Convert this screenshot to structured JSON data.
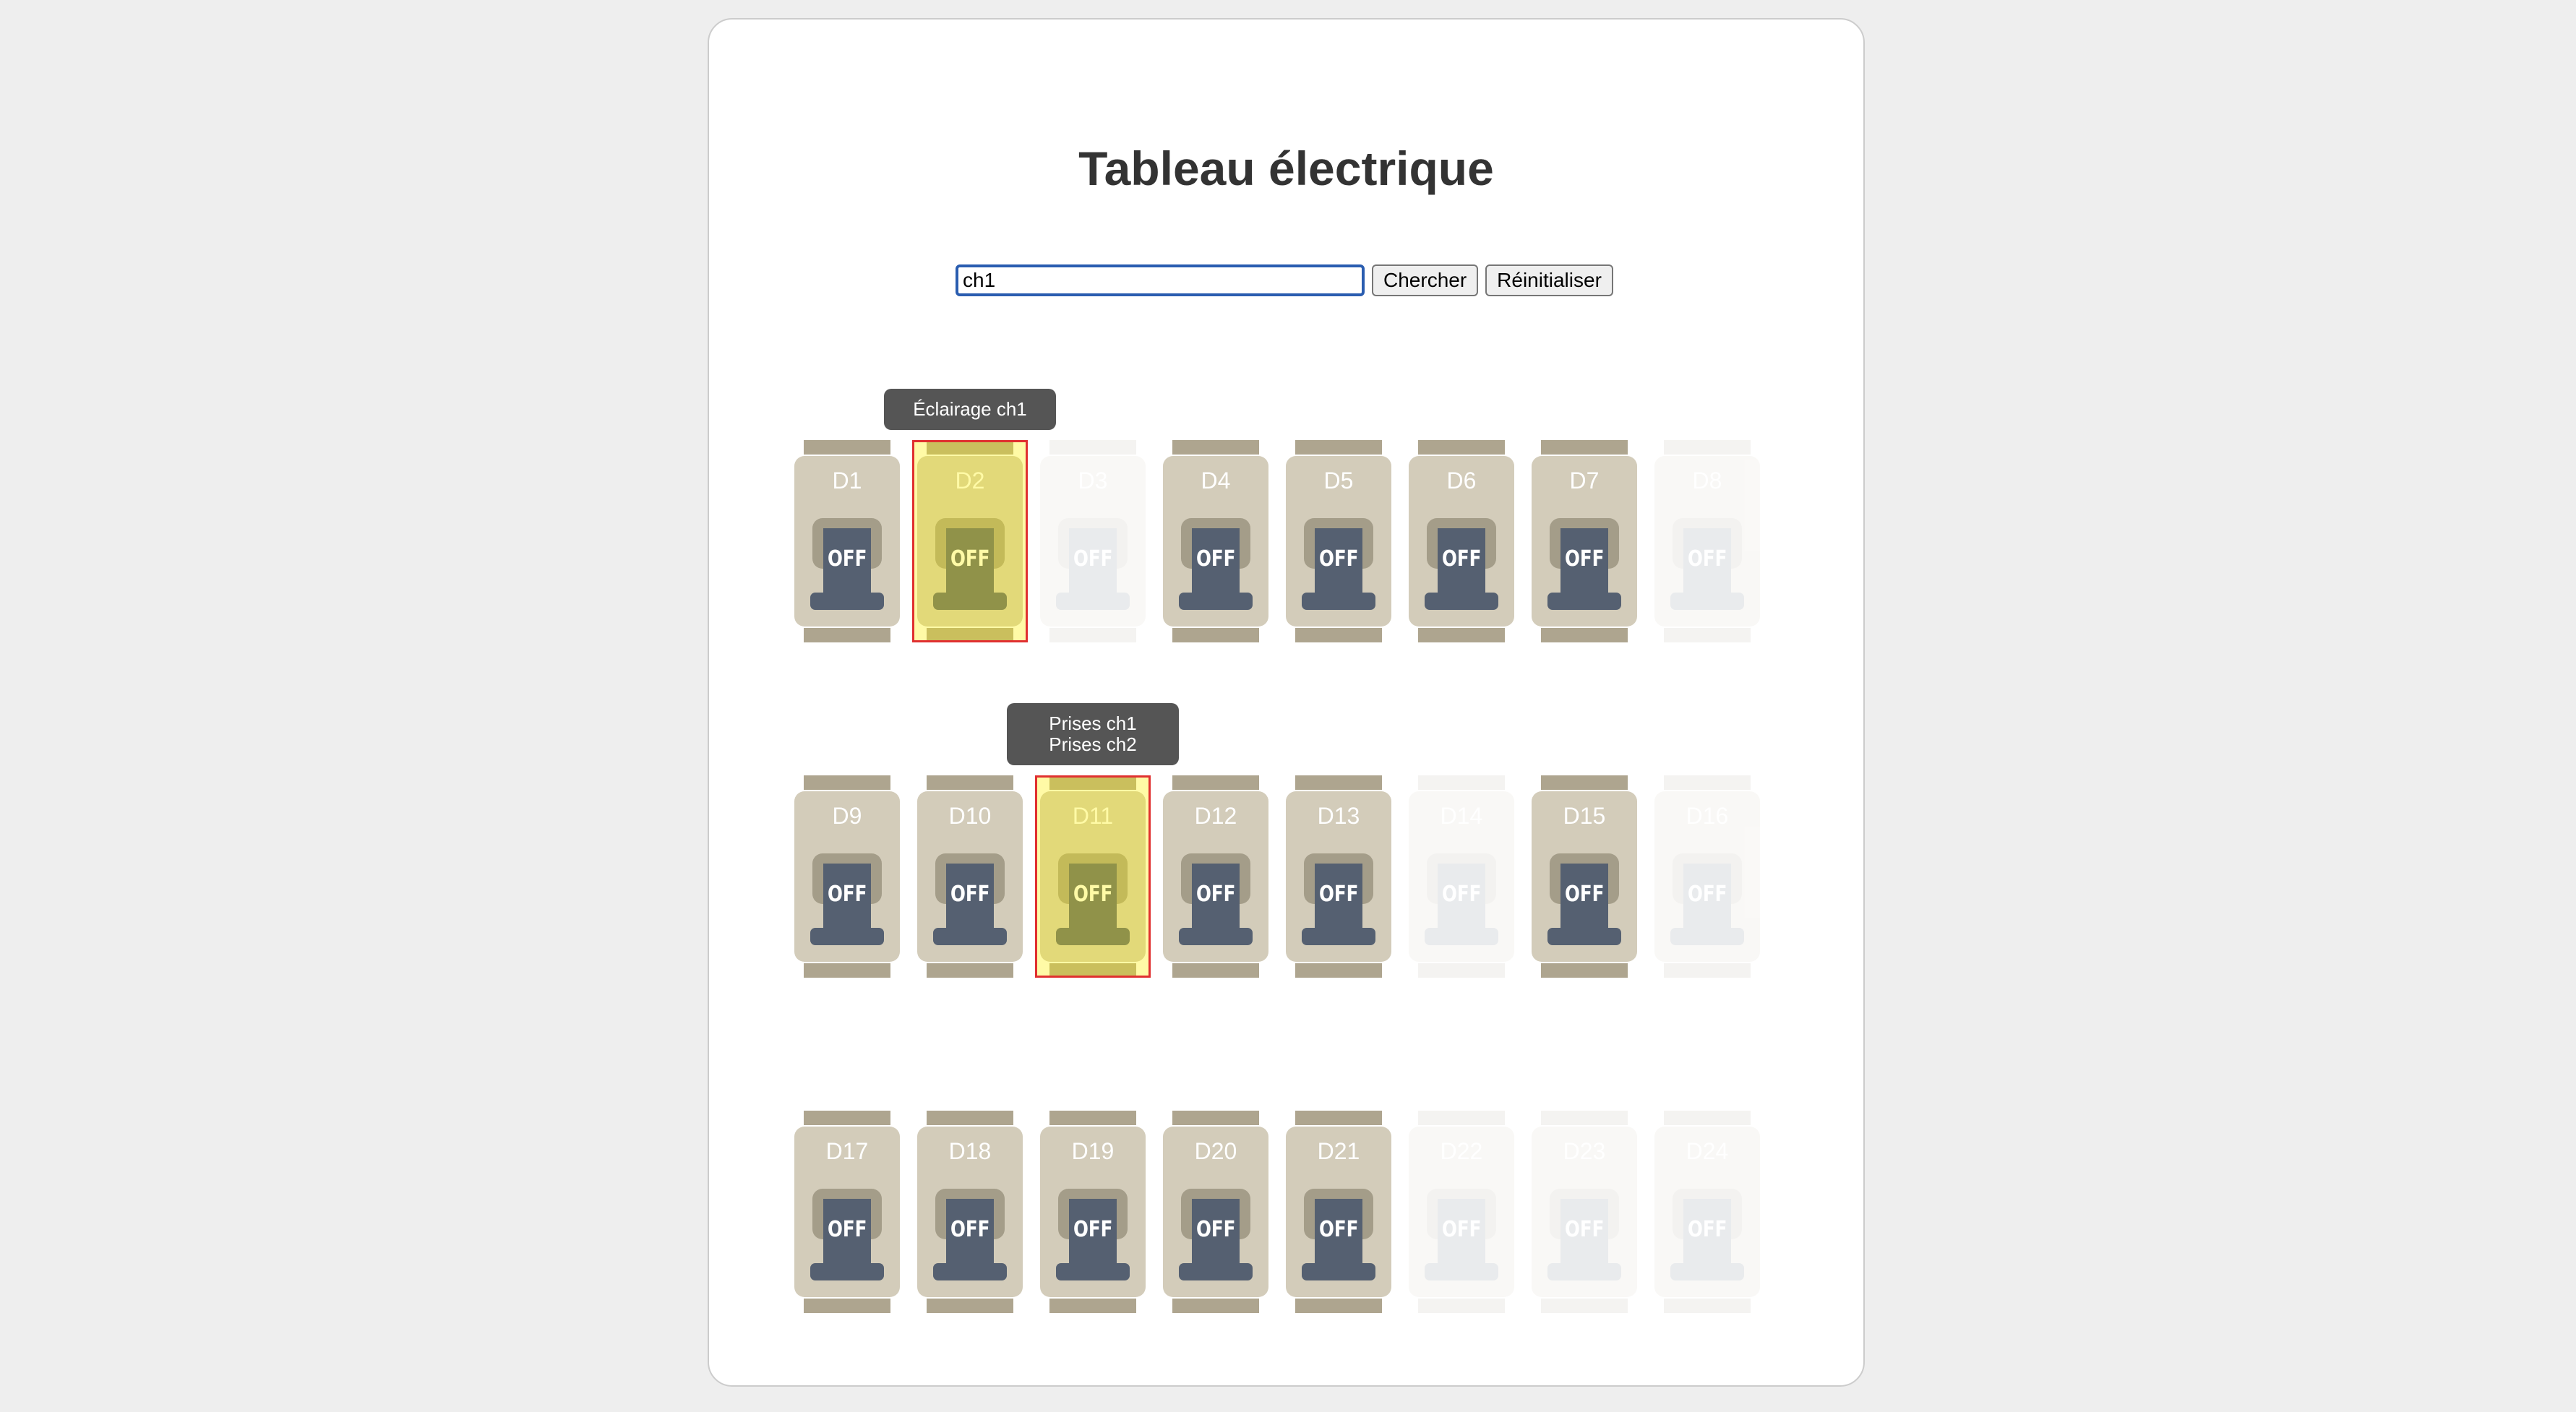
{
  "page": {
    "title": "Tableau électrique"
  },
  "search": {
    "value": "ch1",
    "search_button": "Chercher",
    "reset_button": "Réinitialiser"
  },
  "panel": {
    "off_label": "OFF",
    "rows": [
      [
        {
          "code": "D1",
          "state": "off",
          "present": true,
          "highlight": false
        },
        {
          "code": "D2",
          "state": "off",
          "present": true,
          "highlight": true
        },
        {
          "code": "D3",
          "state": "off",
          "present": false,
          "highlight": false
        },
        {
          "code": "D4",
          "state": "off",
          "present": true,
          "highlight": false
        },
        {
          "code": "D5",
          "state": "off",
          "present": true,
          "highlight": false
        },
        {
          "code": "D6",
          "state": "off",
          "present": true,
          "highlight": false
        },
        {
          "code": "D7",
          "state": "off",
          "present": true,
          "highlight": false
        },
        {
          "code": "D8",
          "state": "off",
          "present": false,
          "highlight": false
        }
      ],
      [
        {
          "code": "D9",
          "state": "off",
          "present": true,
          "highlight": false
        },
        {
          "code": "D10",
          "state": "off",
          "present": true,
          "highlight": false
        },
        {
          "code": "D11",
          "state": "off",
          "present": true,
          "highlight": true
        },
        {
          "code": "D12",
          "state": "off",
          "present": true,
          "highlight": false
        },
        {
          "code": "D13",
          "state": "off",
          "present": true,
          "highlight": false
        },
        {
          "code": "D14",
          "state": "off",
          "present": false,
          "highlight": false
        },
        {
          "code": "D15",
          "state": "off",
          "present": true,
          "highlight": false
        },
        {
          "code": "D16",
          "state": "off",
          "present": false,
          "highlight": false
        }
      ],
      [
        {
          "code": "D17",
          "state": "off",
          "present": true,
          "highlight": false
        },
        {
          "code": "D18",
          "state": "off",
          "present": true,
          "highlight": false
        },
        {
          "code": "D19",
          "state": "off",
          "present": true,
          "highlight": false
        },
        {
          "code": "D20",
          "state": "off",
          "present": true,
          "highlight": false
        },
        {
          "code": "D21",
          "state": "off",
          "present": true,
          "highlight": false
        },
        {
          "code": "D22",
          "state": "off",
          "present": false,
          "highlight": false
        },
        {
          "code": "D23",
          "state": "off",
          "present": false,
          "highlight": false
        },
        {
          "code": "D24",
          "state": "off",
          "present": false,
          "highlight": false
        }
      ]
    ]
  },
  "tooltips": [
    {
      "breaker": "D2",
      "lines": [
        "Éclairage ch1"
      ]
    },
    {
      "breaker": "D11",
      "lines": [
        "Prises ch1",
        "Prises ch2"
      ]
    }
  ],
  "colors": {
    "highlight_border": "#e03030",
    "highlight_fill": "#fff000",
    "breaker_body": "#d3ccba",
    "lever": "#556071",
    "tooltip_bg": "#555555"
  }
}
